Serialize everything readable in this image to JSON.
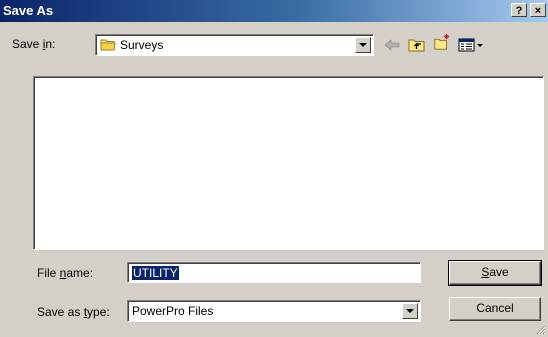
{
  "window": {
    "title": "Save As",
    "help_label": "?",
    "close_label": "×"
  },
  "save_in": {
    "label_pre": "Save ",
    "label_key": "i",
    "label_post": "n:",
    "value": "Surveys",
    "icon": "folder-icon"
  },
  "toolbar": {
    "back_icon": "back-arrow-icon",
    "up_icon": "up-folder-icon",
    "new_folder_icon": "new-folder-icon",
    "views_icon": "view-menu-icon"
  },
  "file_name": {
    "label_pre": "File ",
    "label_key": "n",
    "label_post": "ame:",
    "value": "UTILITY"
  },
  "save_as_type": {
    "label_pre": "Save as ",
    "label_key": "t",
    "label_post": "ype:",
    "value": "PowerPro Files"
  },
  "buttons": {
    "save_key": "S",
    "save_rest": "ave",
    "cancel": "Cancel"
  }
}
